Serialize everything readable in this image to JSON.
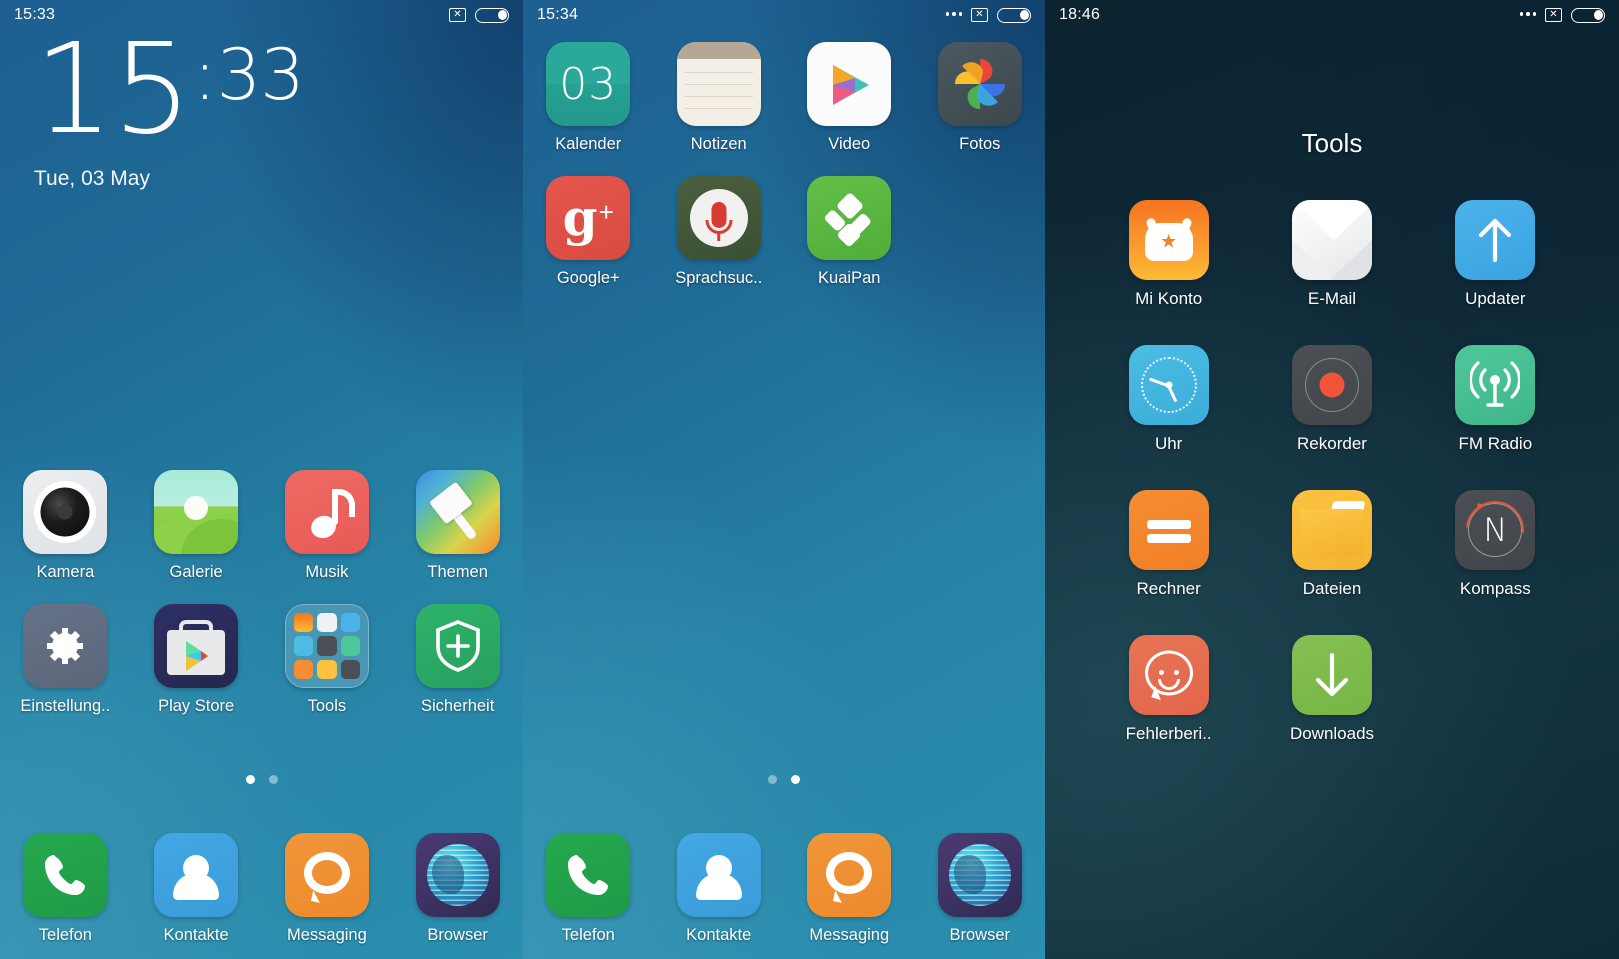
{
  "screens": [
    {
      "name": "lockscreen-home",
      "statusbar": {
        "time": "15:33",
        "overflow": "",
        "x_icon": "✕",
        "battery_label": "battery"
      },
      "clock": {
        "hours": "15",
        "separator": ":",
        "minutes": "33",
        "date": "Tue, 03 May"
      },
      "apps": [
        {
          "label": "Kamera"
        },
        {
          "label": "Galerie"
        },
        {
          "label": "Musik"
        },
        {
          "label": "Themen"
        },
        {
          "label": "Einstellung.."
        },
        {
          "label": "Play Store"
        },
        {
          "label": "Tools"
        },
        {
          "label": "Sicherheit"
        }
      ],
      "dock": [
        {
          "label": "Telefon"
        },
        {
          "label": "Kontakte"
        },
        {
          "label": "Messaging"
        },
        {
          "label": "Browser"
        }
      ],
      "page_indicator": {
        "count": 2,
        "active": 1
      }
    },
    {
      "name": "home-page-2",
      "statusbar": {
        "time": "15:34",
        "overflow": "•••",
        "x_icon": "✕",
        "battery_label": "battery"
      },
      "apps": [
        {
          "label": "Kalender",
          "badge": "03"
        },
        {
          "label": "Notizen"
        },
        {
          "label": "Video"
        },
        {
          "label": "Fotos"
        },
        {
          "label": "Google+"
        },
        {
          "label": "Sprachsuc.."
        },
        {
          "label": "KuaiPan"
        }
      ],
      "dock": [
        {
          "label": "Telefon"
        },
        {
          "label": "Kontakte"
        },
        {
          "label": "Messaging"
        },
        {
          "label": "Browser"
        }
      ],
      "page_indicator": {
        "count": 2,
        "active": 2
      }
    },
    {
      "name": "tools-folder",
      "statusbar": {
        "time": "18:46",
        "overflow": "•••",
        "x_icon": "✕",
        "battery_label": "battery"
      },
      "folder_title": "Tools",
      "apps": [
        {
          "label": "Mi Konto"
        },
        {
          "label": "E-Mail"
        },
        {
          "label": "Updater"
        },
        {
          "label": "Uhr"
        },
        {
          "label": "Rekorder"
        },
        {
          "label": "FM Radio"
        },
        {
          "label": "Rechner"
        },
        {
          "label": "Dateien"
        },
        {
          "label": "Kompass"
        },
        {
          "label": "Fehlerberi.."
        },
        {
          "label": "Downloads"
        }
      ]
    }
  ],
  "colors": {
    "wallpaper_light_teal": "#2b8fb0",
    "wallpaper_dark_navy": "#12416e",
    "folder_background": "#102b39",
    "accent_green": "#25a94f",
    "accent_orange": "#f0963a",
    "accent_blue": "#43a8e4",
    "accent_red": "#e75a56",
    "text_white": "#ffffff"
  }
}
